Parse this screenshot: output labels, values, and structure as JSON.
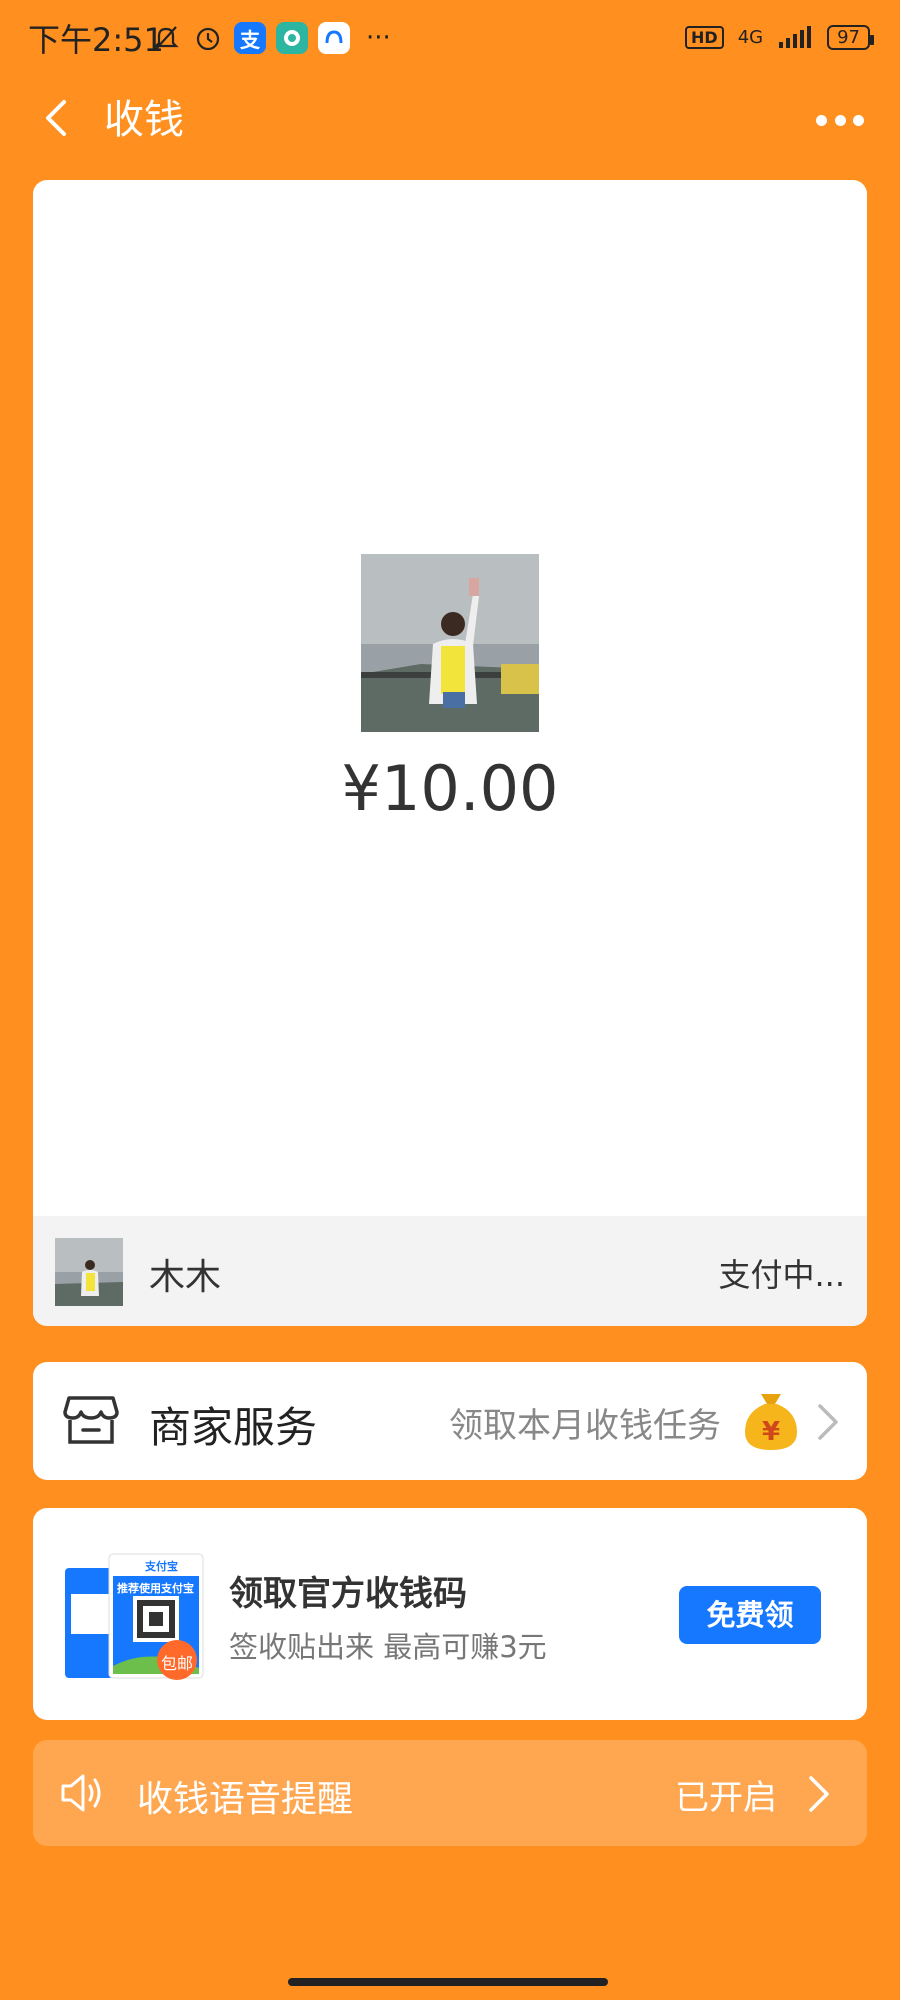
{
  "status_bar": {
    "time": "下午2:51",
    "network": "4G",
    "battery": "97",
    "hd_label": "HD",
    "more_dots": "···"
  },
  "nav": {
    "title": "收钱"
  },
  "receipt": {
    "amount": "¥10.00",
    "payer_name": "木木",
    "payer_status": "支付中..."
  },
  "merchant": {
    "title": "商家服务",
    "subtitle": "领取本月收钱任务"
  },
  "promo": {
    "title": "领取官方收钱码",
    "subtitle": "签收贴出来 最高可赚3元",
    "button_label": "免费领",
    "image_badge": "包邮",
    "image_brand": "支付宝",
    "image_heading": "推荐使用支付宝"
  },
  "voice": {
    "label": "收钱语音提醒",
    "status": "已开启"
  },
  "colors": {
    "background": "#FF8F1F",
    "button_blue": "#1677FF",
    "alipay_blue": "#1677FF"
  }
}
